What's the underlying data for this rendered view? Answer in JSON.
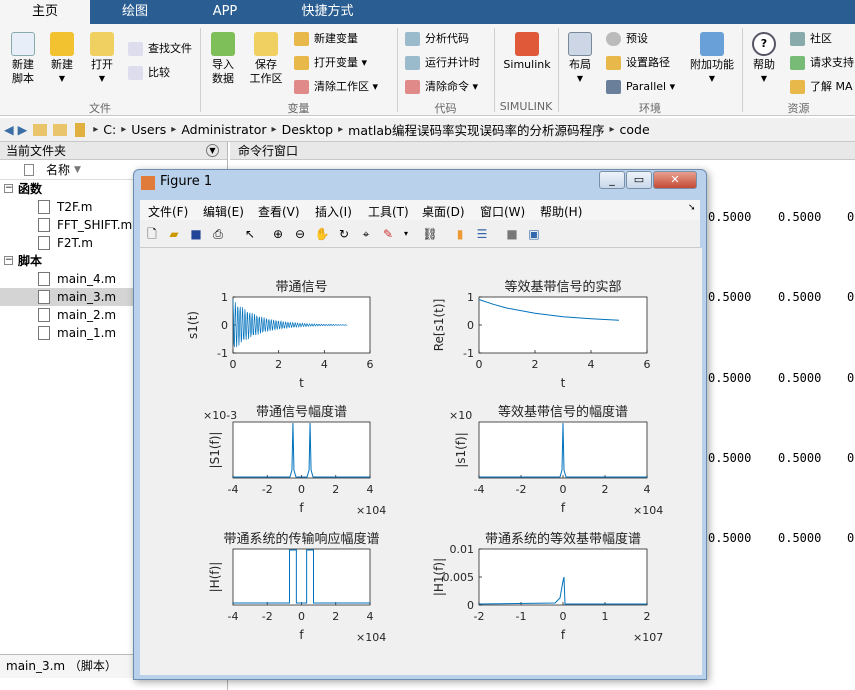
{
  "tabs": [
    "主页",
    "绘图",
    "APP",
    "快捷方式"
  ],
  "ribbon": {
    "new_script": [
      "新建",
      "脚本"
    ],
    "new": "新建",
    "open": "打开",
    "find_files": "查找文件",
    "compare": "比较",
    "import": [
      "导入",
      "数据"
    ],
    "save_ws": [
      "保存",
      "工作区"
    ],
    "new_var": "新建变量",
    "open_var": "打开变量",
    "clear_ws": "清除工作区",
    "analyze_code": "分析代码",
    "run_time": "运行并计时",
    "clear_cmd": "清除命令",
    "simulink": "Simulink",
    "layout": "布局",
    "prefs": "预设",
    "set_path": "设置路径",
    "parallel": "Parallel",
    "addons": "附加功能",
    "help": "帮助",
    "community": "社区",
    "request_support": "请求支持",
    "learn": "了解 MA",
    "groups": [
      "文件",
      "变量",
      "代码",
      "SIMULINK",
      "环境",
      "资源"
    ]
  },
  "address": [
    "C:",
    "Users",
    "Administrator",
    "Desktop",
    "matlab编程误码率实现误码率的分析源码程序",
    "code"
  ],
  "current_folder": {
    "title": "当前文件夹",
    "name_col": "名称",
    "functions_label": "函数",
    "functions": [
      "T2F.m",
      "FFT_SHIFT.m",
      "F2T.m"
    ],
    "scripts_label": "脚本",
    "scripts": [
      "main_4.m",
      "main_3.m",
      "main_2.m",
      "main_1.m"
    ],
    "selected": "main_3.m"
  },
  "status": "main_3.m （脚本）",
  "command_window": {
    "title": "命令行窗口",
    "values": [
      "0.5000",
      "0.5000",
      "0"
    ]
  },
  "figure": {
    "title": "Figure 1",
    "menu": [
      "文件(F)",
      "编辑(E)",
      "查看(V)",
      "插入(I)",
      "工具(T)",
      "桌面(D)",
      "窗口(W)",
      "帮助(H)"
    ]
  },
  "chart_data": [
    {
      "type": "line",
      "title": "带通信号",
      "xlabel": "t",
      "ylabel": "s1(t)",
      "xlim": [
        0,
        6
      ],
      "ylim": [
        -1,
        1
      ],
      "xticks": [
        "0",
        "2",
        "4",
        "6"
      ],
      "yticks": [
        "-1",
        "0",
        "1"
      ],
      "desc_points": [
        [
          0,
          0.9
        ],
        [
          5,
          0.01
        ]
      ]
    },
    {
      "type": "line",
      "title": "等效基带信号的实部",
      "xlabel": "t",
      "ylabel": "Re[s1(t)]",
      "xlim": [
        0,
        6
      ],
      "ylim": [
        -1,
        1
      ],
      "xticks": [
        "0",
        "2",
        "4",
        "6"
      ],
      "yticks": [
        "-1",
        "0",
        "1"
      ],
      "x": [
        0,
        0.5,
        1,
        2,
        3,
        4,
        5
      ],
      "y": [
        0.98,
        0.8,
        0.65,
        0.45,
        0.32,
        0.24,
        0.18
      ]
    },
    {
      "type": "line",
      "title": "带通信号幅度谱",
      "xlabel": "f",
      "ylabel": "|S1(f)|",
      "xlim": [
        -4,
        4
      ],
      "xexp": "×10^4",
      "yexp": "×10^-3",
      "xticks": [
        "-4",
        "-2",
        "0",
        "2",
        "4"
      ],
      "peaks": [
        -0.5,
        0.5
      ]
    },
    {
      "type": "line",
      "title": "等效基带信号的幅度谱",
      "xlabel": "f",
      "ylabel": "|s1(f)|",
      "xlim": [
        -4,
        4
      ],
      "xexp": "×10^4",
      "yexp": "×10^",
      "xticks": [
        "-4",
        "-2",
        "0",
        "2",
        "4"
      ],
      "peaks": [
        0
      ]
    },
    {
      "type": "line",
      "title": "带通系统的传输响应幅度谱",
      "xlabel": "f",
      "ylabel": "|H(f)|",
      "xlim": [
        -4,
        4
      ],
      "xexp": "×10^4",
      "xticks": [
        "-4",
        "-2",
        "0",
        "2",
        "4"
      ],
      "passbands": [
        [
          -0.7,
          -0.3
        ],
        [
          0.3,
          0.7
        ]
      ]
    },
    {
      "type": "line",
      "title": "带通系统的等效基带幅度谱",
      "xlabel": "f",
      "ylabel": "|H1(f)|",
      "xlim": [
        -2,
        2
      ],
      "ylim": [
        0,
        0.01
      ],
      "xexp": "×10^7",
      "xticks": [
        "-2",
        "-1",
        "0",
        "1",
        "2"
      ],
      "yticks": [
        "0",
        "0.005",
        "0.01"
      ],
      "peak_value": 0.005
    }
  ]
}
